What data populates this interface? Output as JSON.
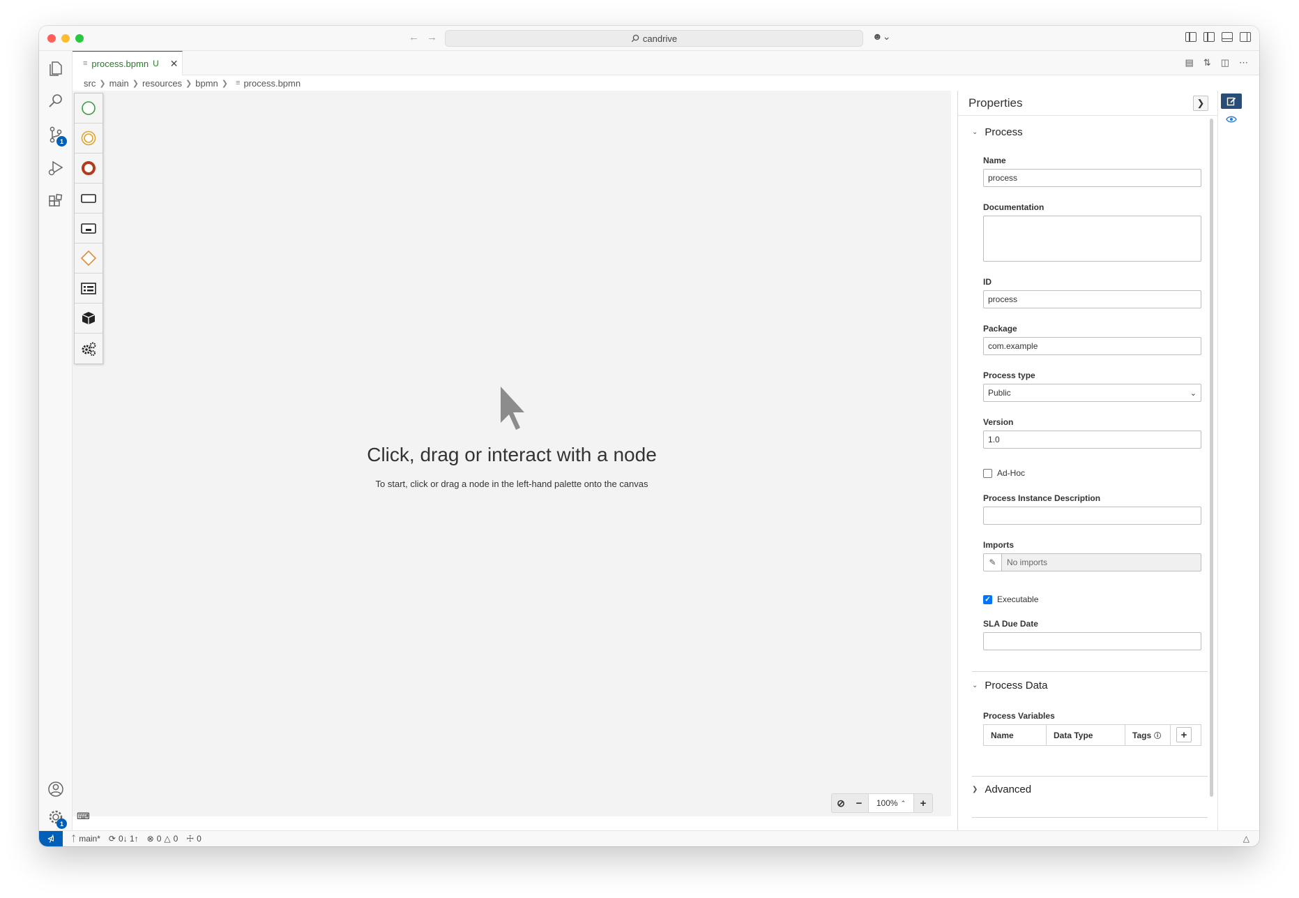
{
  "window": {
    "search_text": "candrive",
    "colors": {
      "accent": "#005fb8",
      "start_event": "#3b9d3b",
      "intermediate_event": "#e0a02a",
      "end_event": "#b33a1d",
      "gateway": "#e08a3c"
    }
  },
  "tab": {
    "title": "process.bpmn",
    "modified_marker": "U"
  },
  "breadcrumb": [
    "src",
    "main",
    "resources",
    "bpmn",
    "process.bpmn"
  ],
  "activity_bar": {
    "items": [
      "explorer-icon",
      "search-icon",
      "source-control-icon",
      "run-debug-icon",
      "extensions-icon"
    ],
    "source_control_badge": "1",
    "settings_badge": "1"
  },
  "palette": {
    "items": [
      "start-event-icon",
      "intermediate-event-icon",
      "end-event-icon",
      "task-icon",
      "subprocess-icon",
      "gateway-icon",
      "lane-icon",
      "data-object-icon",
      "settings-gears-icon"
    ]
  },
  "canvas": {
    "title": "Click, drag or interact with a node",
    "subtitle": "To start, click or drag a node in the left-hand palette onto the canvas",
    "zoom": "100%"
  },
  "properties": {
    "title": "Properties",
    "process_section": "Process",
    "name_label": "Name",
    "name_value": "process",
    "documentation_label": "Documentation",
    "documentation_value": "",
    "id_label": "ID",
    "id_value": "process",
    "package_label": "Package",
    "package_value": "com.example",
    "process_type_label": "Process type",
    "process_type_value": "Public",
    "version_label": "Version",
    "version_value": "1.0",
    "adhoc_label": "Ad-Hoc",
    "adhoc_checked": false,
    "instance_desc_label": "Process Instance Description",
    "instance_desc_value": "",
    "imports_label": "Imports",
    "imports_value": "No imports",
    "executable_label": "Executable",
    "executable_checked": true,
    "sla_label": "SLA Due Date",
    "sla_value": "",
    "process_data_section": "Process Data",
    "variables_label": "Process Variables",
    "variables_columns": [
      "Name",
      "Data Type",
      "Tags"
    ],
    "add_symbol": "+",
    "advanced_section": "Advanced"
  },
  "statusbar": {
    "branch": "main*",
    "sync": "0↓ 1↑",
    "errors": "0",
    "warnings": "0",
    "ports": "0"
  }
}
